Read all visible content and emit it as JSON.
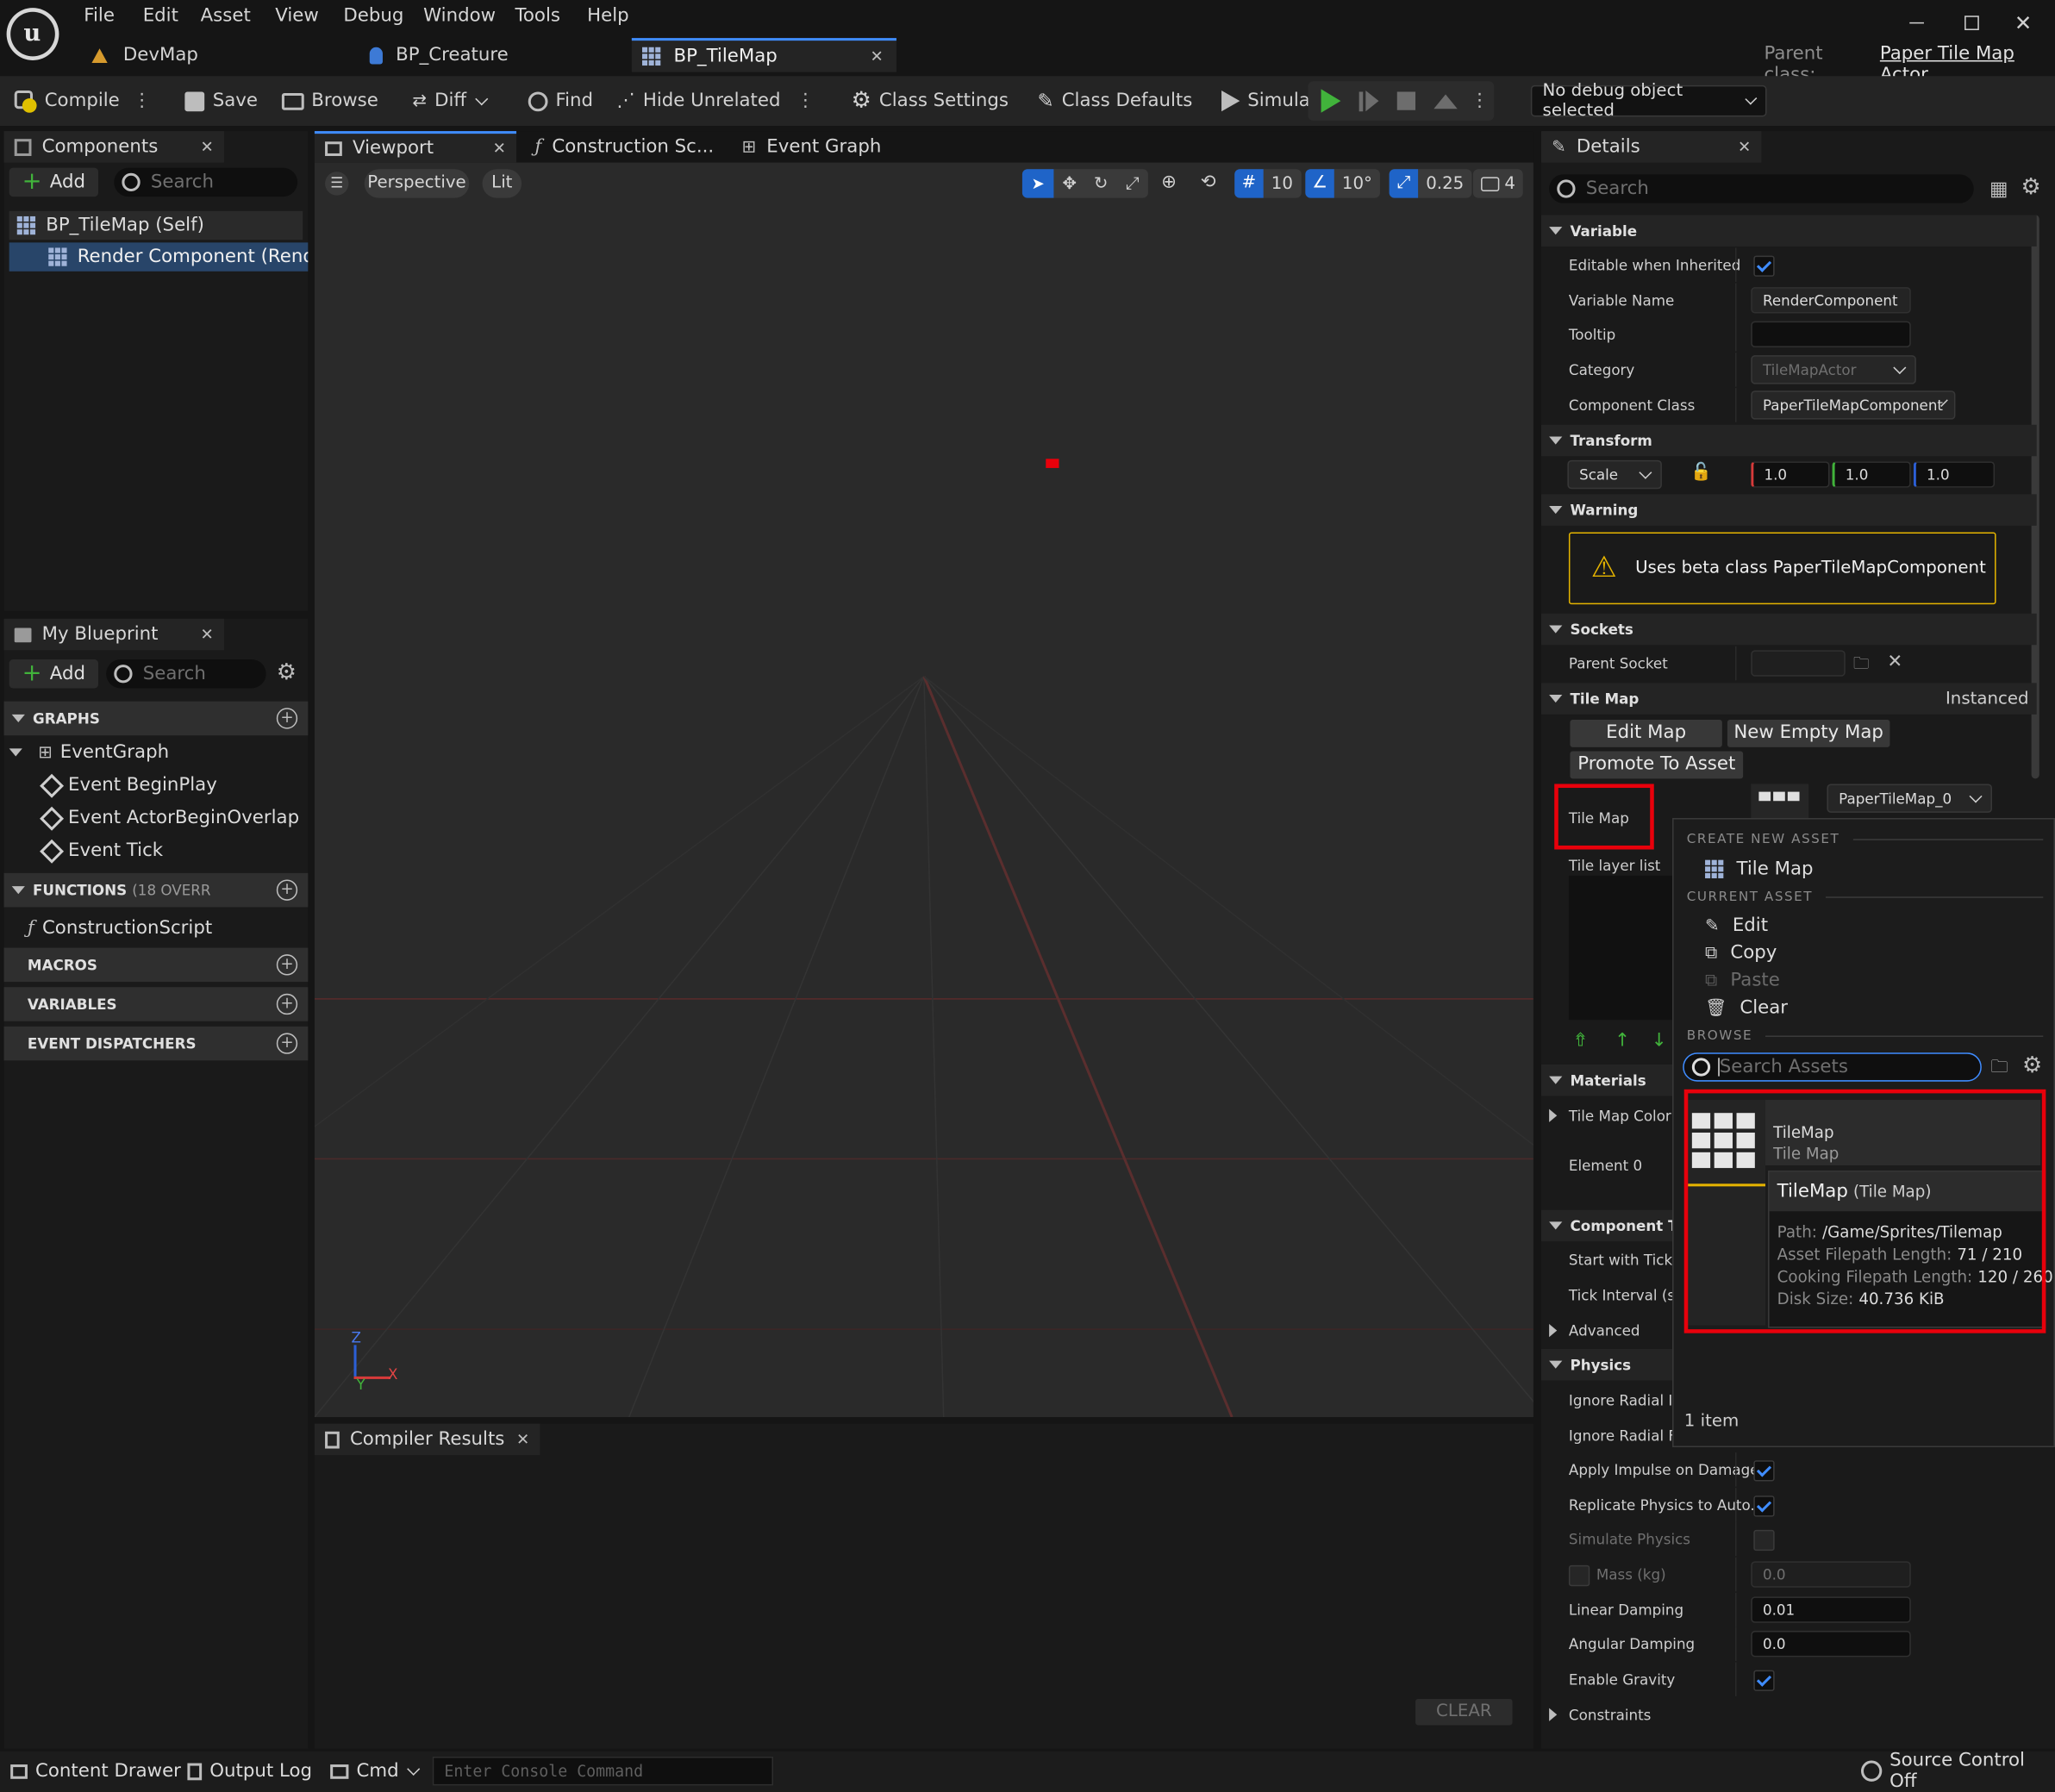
{
  "menu": [
    "File",
    "Edit",
    "Asset",
    "View",
    "Debug",
    "Window",
    "Tools",
    "Help"
  ],
  "doc_tabs": [
    {
      "label": "DevMap"
    },
    {
      "label": "BP_Creature"
    },
    {
      "label": "BP_TileMap"
    }
  ],
  "parent_class": {
    "label": "Parent class:",
    "value": "Paper Tile Map Actor"
  },
  "toolbar": {
    "compile": "Compile",
    "save": "Save",
    "browse": "Browse",
    "diff": "Diff",
    "find": "Find",
    "hide_unrelated": "Hide Unrelated",
    "class_settings": "Class Settings",
    "class_defaults": "Class Defaults",
    "simulation": "Simulation",
    "debug_object": "No debug object selected"
  },
  "components": {
    "tab": "Components",
    "add": "Add",
    "search_placeholder": "Search",
    "items": [
      "BP_TileMap (Self)",
      "Render Component (RenderCo"
    ]
  },
  "my_blueprint": {
    "tab": "My Blueprint",
    "add": "Add",
    "search_placeholder": "Search",
    "graphs": "GRAPHS",
    "event_graph": "EventGraph",
    "events": [
      "Event BeginPlay",
      "Event ActorBeginOverlap",
      "Event Tick"
    ],
    "functions": "FUNCTIONS",
    "functions_count": "(18 OVERR",
    "construction_script": "ConstructionScript",
    "macros": "MACROS",
    "variables": "VARIABLES",
    "dispatchers": "EVENT DISPATCHERS"
  },
  "center_tabs": [
    "Viewport",
    "Construction Sc...",
    "Event Graph"
  ],
  "viewport": {
    "perspective": "Perspective",
    "lit": "Lit",
    "grid_snap": "10",
    "rot_snap": "10°",
    "scale_snap": "0.25",
    "cam_speed": "4",
    "axis_x": "X",
    "axis_y": "Y",
    "axis_z": "Z"
  },
  "compiler": {
    "tab": "Compiler Results",
    "clear": "CLEAR"
  },
  "details": {
    "tab": "Details",
    "search_placeholder": "Search",
    "variable": "Variable",
    "editable_when_inherited": "Editable when Inherited",
    "variable_name_label": "Variable Name",
    "variable_name": "RenderComponent",
    "tooltip": "Tooltip",
    "category_label": "Category",
    "category": "TileMapActor",
    "component_class_label": "Component Class",
    "component_class": "PaperTileMapComponent",
    "transform": "Transform",
    "scale": "Scale",
    "scale_x": "1.0",
    "scale_y": "1.0",
    "scale_z": "1.0",
    "warning": "Warning",
    "warning_text": "Uses beta class PaperTileMapComponent",
    "sockets": "Sockets",
    "parent_socket": "Parent Socket",
    "tile_map_section": "Tile Map",
    "instanced": "Instanced",
    "edit_map": "Edit Map",
    "new_empty_map": "New Empty Map",
    "promote_to_asset": "Promote To Asset",
    "tile_map_label": "Tile Map",
    "tile_map_value": "PaperTileMap_0",
    "tile_layer_list": "Tile layer list",
    "materials": "Materials",
    "tile_map_color": "Tile Map Color",
    "element0": "Element 0",
    "component_tick": "Component Tick",
    "start_with_tick": "Start with Tick E",
    "tick_interval": "Tick Interval (sec",
    "advanced": "Advanced",
    "physics": "Physics",
    "ignore_radial_im": "Ignore Radial Im",
    "ignore_radial_fo": "Ignore Radial Fo",
    "apply_impulse": "Apply Impulse on Damage",
    "replicate_physics": "Replicate Physics to Auto...",
    "simulate_physics": "Simulate Physics",
    "mass": "Mass (kg)",
    "mass_value": "0.0",
    "linear_damping": "Linear Damping",
    "linear_damping_value": "0.01",
    "angular_damping": "Angular Damping",
    "angular_damping_value": "0.0",
    "enable_gravity": "Enable Gravity",
    "constraints": "Constraints"
  },
  "popup": {
    "create_new_asset": "CREATE NEW ASSET",
    "tile_map": "Tile Map",
    "current_asset": "CURRENT ASSET",
    "edit": "Edit",
    "copy": "Copy",
    "paste": "Paste",
    "clear": "Clear",
    "browse": "BROWSE",
    "search_placeholder": "Search Assets",
    "asset_name": "TileMap",
    "asset_type": "Tile Map",
    "tooltip_title": "TileMap",
    "tooltip_type": "(Tile Map)",
    "path_label": "Path:",
    "path": "/Game/Sprites/Tilemap",
    "asset_len_label": "Asset Filepath Length:",
    "asset_len": "71 / 210",
    "cook_len_label": "Cooking Filepath Length:",
    "cook_len": "120 / 260",
    "disk_label": "Disk Size:",
    "disk": "40.736 KiB",
    "count": "1 item"
  },
  "statusbar": {
    "content_drawer": "Content Drawer",
    "output_log": "Output Log",
    "cmd": "Cmd",
    "console_placeholder": "Enter Console Command",
    "source_control": "Source Control Off"
  },
  "colors": {
    "highlight": "#e8000b",
    "accent": "#3f8cff",
    "play": "#41b33b",
    "warning": "#e5b400"
  }
}
